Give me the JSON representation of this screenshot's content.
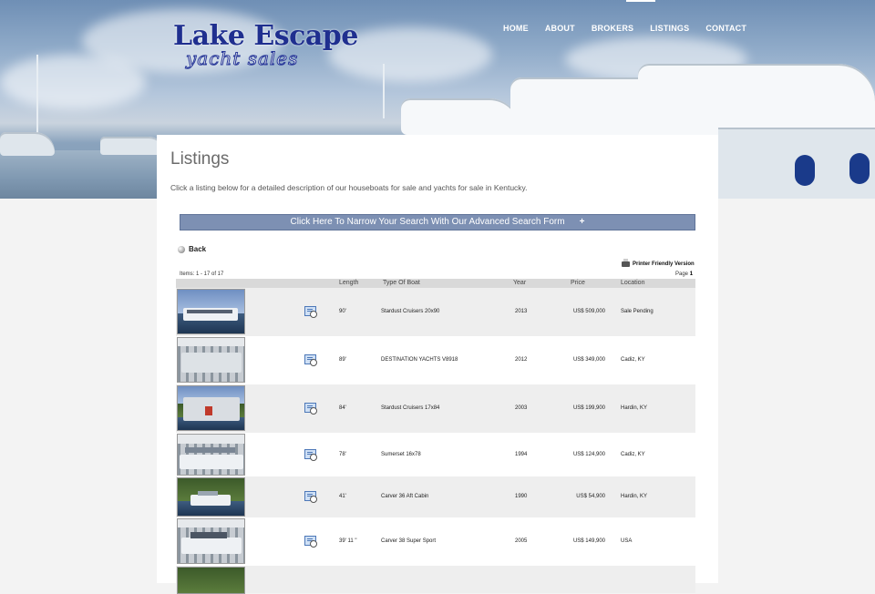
{
  "site": {
    "logo_main": "Lake Escape",
    "logo_sub": "yacht sales"
  },
  "nav": {
    "items": [
      {
        "label": "HOME"
      },
      {
        "label": "ABOUT"
      },
      {
        "label": "BROKERS"
      },
      {
        "label": "LISTINGS"
      },
      {
        "label": "CONTACT"
      }
    ],
    "active": "LISTINGS"
  },
  "page": {
    "title": "Listings",
    "intro": "Click a listing below for a detailed description of our houseboats for sale and yachts for sale in Kentucky."
  },
  "search": {
    "label": "Click Here To Narrow Your Search With Our Advanced Search Form",
    "icon": "plus-icon"
  },
  "back": {
    "label": "Back"
  },
  "print": {
    "label": "Printer Friendly Version"
  },
  "pager": {
    "items_text": "Items: 1 - 17 of 17",
    "page_label": "Page",
    "page_number": "1"
  },
  "table": {
    "columns": [
      "Length",
      "Type Of Boat",
      "Year",
      "Price",
      "Location"
    ],
    "rows": [
      {
        "length": "90'",
        "type": "Stardust Cruisers 20x90",
        "year": "2013",
        "price": "US$ 509,000",
        "location": "Sale Pending"
      },
      {
        "length": "89'",
        "type": "DESTINATION YACHTS V8918",
        "year": "2012",
        "price": "US$ 349,000",
        "location": "Cadiz, KY"
      },
      {
        "length": "84'",
        "type": "Stardust Cruisers 17x84",
        "year": "2003",
        "price": "US$ 199,900",
        "location": "Hardin, KY"
      },
      {
        "length": "78'",
        "type": "Sumerset 16x78",
        "year": "1994",
        "price": "US$ 124,900",
        "location": "Cadiz, KY"
      },
      {
        "length": "41'",
        "type": "Carver 36 Aft Cabin",
        "year": "1990",
        "price": "US$ 54,900",
        "location": "Hardin, KY"
      },
      {
        "length": "39' 11 \"",
        "type": "Carver 38 Super Sport",
        "year": "2005",
        "price": "US$ 149,900",
        "location": "USA"
      }
    ]
  },
  "colors": {
    "logo_blue": "#1f2f8f",
    "search_bar": "#7d90b3",
    "header_row": "#d9d9d9",
    "alt_row": "#eeeeee"
  }
}
